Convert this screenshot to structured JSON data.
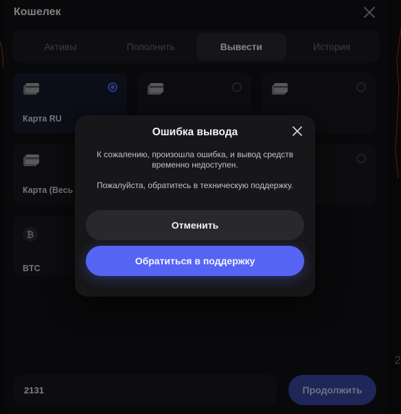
{
  "wallet": {
    "title": "Кошелек",
    "tabs": [
      {
        "label": "Активы",
        "active": false
      },
      {
        "label": "Пополнить",
        "active": false
      },
      {
        "label": "Вывести",
        "active": true
      },
      {
        "label": "История",
        "active": false
      }
    ],
    "methods": [
      {
        "label": "Карта RU",
        "icon": "credit-card-icon",
        "selected": true
      },
      {
        "label": "",
        "icon": "credit-card-icon",
        "selected": false
      },
      {
        "label": "",
        "icon": "credit-card-icon",
        "selected": false
      },
      {
        "label": "Карта (Весь",
        "icon": "credit-card-icon",
        "selected": false
      },
      {
        "label": "",
        "icon": "",
        "selected": false
      },
      {
        "label": "",
        "icon": "",
        "selected": false
      },
      {
        "label": "BTC",
        "icon": "bitcoin-icon",
        "selected": false
      }
    ],
    "btc_symbol": "₿",
    "amount_value": "2131",
    "continue_label": "Продолжить"
  },
  "background": {
    "digit": "2"
  },
  "modal": {
    "title": "Ошибка вывода",
    "message_1": "К сожалению, произошла ошибка, и вывод средств временно недоступен.",
    "message_2": "Пожалуйста, обратитесь в техническую поддержку.",
    "cancel_label": "Отменить",
    "support_label": "Обратиться в поддержку"
  },
  "colors": {
    "accent": "#5664f4",
    "radio_on": "#4e6cf4",
    "bg_line": "#c2421a"
  }
}
